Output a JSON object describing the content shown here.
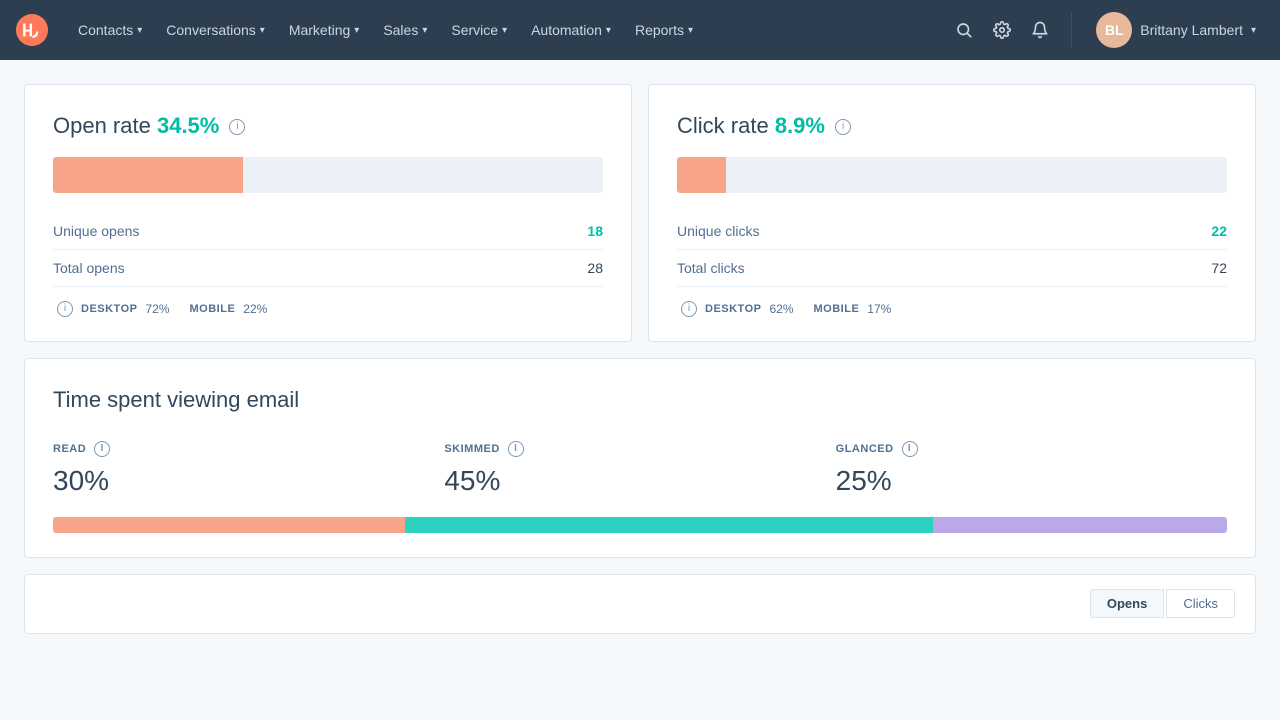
{
  "navbar": {
    "logo_alt": "HubSpot",
    "items": [
      {
        "label": "Contacts",
        "id": "contacts"
      },
      {
        "label": "Conversations",
        "id": "conversations"
      },
      {
        "label": "Marketing",
        "id": "marketing"
      },
      {
        "label": "Sales",
        "id": "sales"
      },
      {
        "label": "Service",
        "id": "service"
      },
      {
        "label": "Automation",
        "id": "automation"
      },
      {
        "label": "Reports",
        "id": "reports"
      }
    ],
    "user_name": "Brittany Lambert"
  },
  "open_rate_card": {
    "title": "Open rate",
    "rate_value": "34.5%",
    "bar_fill_pct": 34.5,
    "unique_opens_label": "Unique opens",
    "unique_opens_value": "18",
    "total_opens_label": "Total opens",
    "total_opens_value": "28",
    "desktop_label": "DESKTOP",
    "desktop_value": "72%",
    "mobile_label": "MOBILE",
    "mobile_value": "22%"
  },
  "click_rate_card": {
    "title": "Click rate",
    "rate_value": "8.9%",
    "bar_fill_pct": 8.9,
    "unique_clicks_label": "Unique clicks",
    "unique_clicks_value": "22",
    "total_clicks_label": "Total clicks",
    "total_clicks_value": "72",
    "desktop_label": "DESKTOP",
    "desktop_value": "62%",
    "mobile_label": "MOBILE",
    "mobile_value": "17%"
  },
  "time_card": {
    "title": "Time spent viewing email",
    "read_label": "READ",
    "read_value": "30%",
    "read_pct": 30,
    "skimmed_label": "SKIMMED",
    "skimmed_value": "45%",
    "skimmed_pct": 45,
    "glanced_label": "GLANCED",
    "glanced_value": "25%",
    "glanced_pct": 25
  },
  "bottom_panel": {
    "tabs": [
      {
        "label": "Opens",
        "active": true
      },
      {
        "label": "Clicks",
        "active": false
      }
    ]
  }
}
